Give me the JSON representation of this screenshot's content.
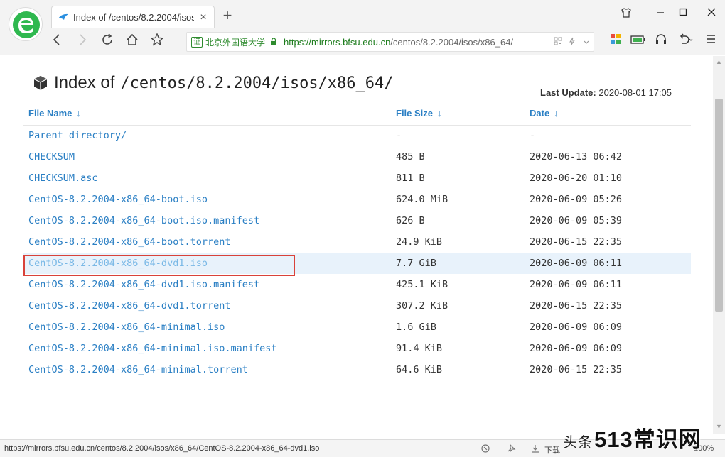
{
  "browser": {
    "tab_title": "Index of /centos/8.2.2004/isos",
    "tab_close": "×",
    "new_tab": "+",
    "cert_label": "证",
    "cert_org": "北京外国语大学",
    "url_scheme_host": "https://mirrors.bfsu.edu.cn",
    "url_path": "/centos/8.2.2004/isos/x86_64/",
    "accent": "#2a7fc4"
  },
  "page": {
    "title_prefix": "Index of",
    "title_path": "/centos/8.2.2004/isos/x86_64/",
    "last_update_label": "Last Update:",
    "last_update_value": "2020-08-01 17:05",
    "columns": {
      "name": "File Name",
      "size": "File Size",
      "date": "Date",
      "sort_arrow": "↓"
    },
    "rows": [
      {
        "name": "Parent directory/",
        "size": "-",
        "date": "-"
      },
      {
        "name": "CHECKSUM",
        "size": "485 B",
        "date": "2020-06-13 06:42"
      },
      {
        "name": "CHECKSUM.asc",
        "size": "811 B",
        "date": "2020-06-20 01:10"
      },
      {
        "name": "CentOS-8.2.2004-x86_64-boot.iso",
        "size": "624.0 MiB",
        "date": "2020-06-09 05:26"
      },
      {
        "name": "CentOS-8.2.2004-x86_64-boot.iso.manifest",
        "size": "626 B",
        "date": "2020-06-09 05:39"
      },
      {
        "name": "CentOS-8.2.2004-x86_64-boot.torrent",
        "size": "24.9 KiB",
        "date": "2020-06-15 22:35"
      },
      {
        "name": "CentOS-8.2.2004-x86_64-dvd1.iso",
        "size": "7.7 GiB",
        "date": "2020-06-09 06:11"
      },
      {
        "name": "CentOS-8.2.2004-x86_64-dvd1.iso.manifest",
        "size": "425.1 KiB",
        "date": "2020-06-09 06:11"
      },
      {
        "name": "CentOS-8.2.2004-x86_64-dvd1.torrent",
        "size": "307.2 KiB",
        "date": "2020-06-15 22:35"
      },
      {
        "name": "CentOS-8.2.2004-x86_64-minimal.iso",
        "size": "1.6 GiB",
        "date": "2020-06-09 06:09"
      },
      {
        "name": "CentOS-8.2.2004-x86_64-minimal.iso.manifest",
        "size": "91.4 KiB",
        "date": "2020-06-09 06:09"
      },
      {
        "name": "CentOS-8.2.2004-x86_64-minimal.torrent",
        "size": "64.6 KiB",
        "date": "2020-06-15 22:35"
      }
    ]
  },
  "status": {
    "url": "https://mirrors.bfsu.edu.cn/centos/8.2.2004/isos/x86_64/CentOS-8.2.2004-x86_64-dvd1.iso",
    "download_label": "下载",
    "zoom": "100%"
  },
  "watermark": {
    "prefix": "头条",
    "text": "513常识网"
  }
}
